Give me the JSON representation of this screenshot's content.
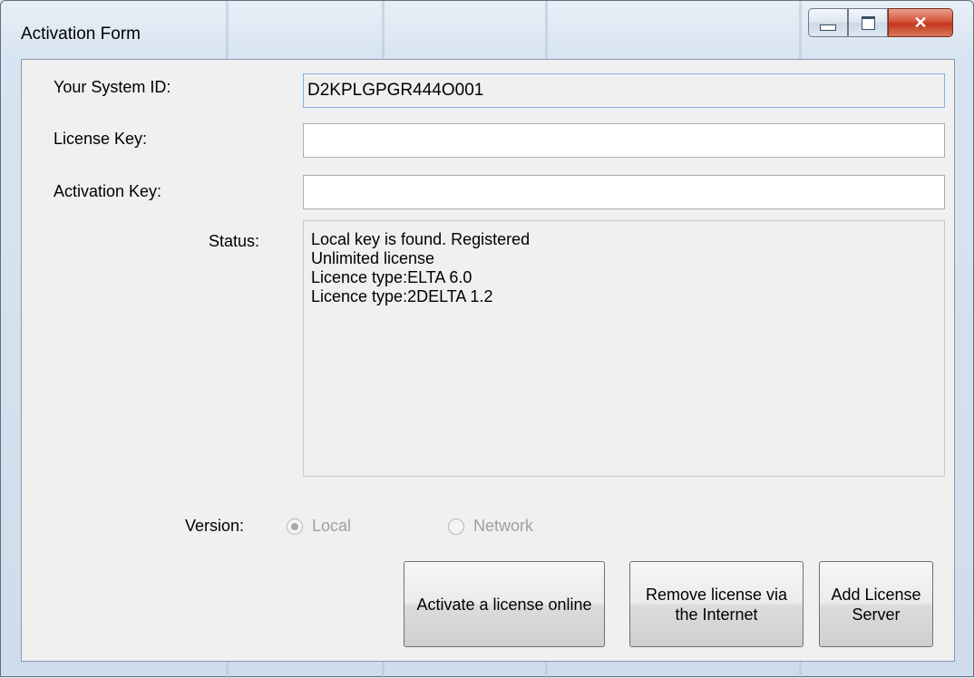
{
  "window": {
    "title": "Activation Form",
    "close_glyph": "✕"
  },
  "form": {
    "system_id_label": "Your System ID:",
    "system_id_value": "D2KPLGPGR444O001",
    "license_key_label": "License Key:",
    "license_key_value": "",
    "activation_key_label": "Activation Key:",
    "activation_key_value": "",
    "status_label": "Status:",
    "status_lines": [
      "Local key is found. Registered",
      "Unlimited license",
      "Licence type:ELTA 6.0",
      "Licence type:2DELTA 1.2"
    ],
    "version_label": "Version:",
    "version_options": [
      "Local",
      "Network"
    ],
    "version_selected": "Local"
  },
  "buttons": {
    "activate_online": "Activate a license online",
    "remove_license": "Remove license via the Internet",
    "add_server": "Add License Server"
  },
  "colors": {
    "close_button": "#c2361b",
    "readonly_border": "#7eb4ea"
  },
  "icons": {
    "minimize": "minimize-icon",
    "maximize": "maximize-icon",
    "close": "close-icon"
  }
}
